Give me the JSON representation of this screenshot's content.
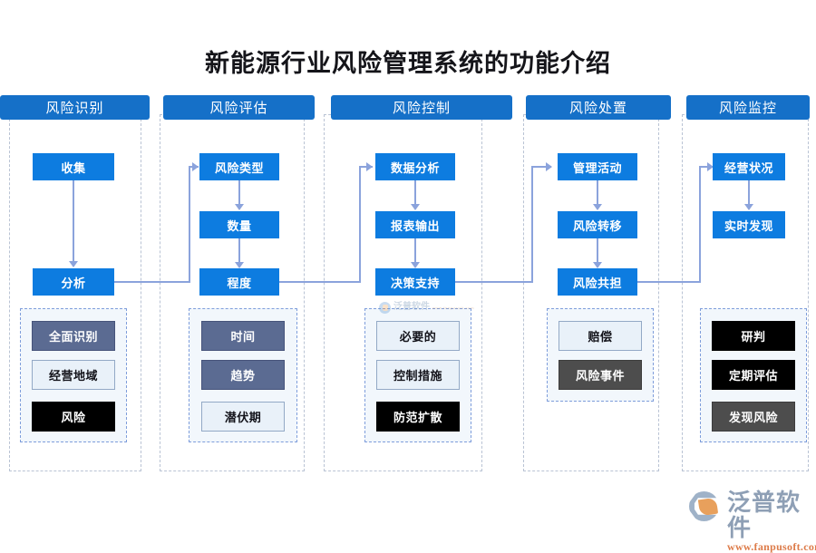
{
  "title": "新能源行业风险管理系统的功能介绍",
  "colors": {
    "header_blue": "#1570c8",
    "box_blue": "#0d7ce0",
    "connector": "#8ba3dc",
    "panel_dash": "#7e9ddb",
    "panel_fill": "#f2f7fc",
    "slate": "#5b6b92",
    "light": "#e9f1f9",
    "black": "#000000",
    "gray": "#4d4d4d",
    "logo_text": "#8e9fb5",
    "logo_url": "#dd7b49"
  },
  "columns": [
    {
      "header": "风险识别",
      "flow": [
        "收集",
        "分析"
      ],
      "items": [
        {
          "label": "全面识别",
          "style": "slate"
        },
        {
          "label": "经营地域",
          "style": "light"
        },
        {
          "label": "风险",
          "style": "black"
        }
      ]
    },
    {
      "header": "风险评估",
      "flow": [
        "风险类型",
        "数量",
        "程度"
      ],
      "items": [
        {
          "label": "时间",
          "style": "slate"
        },
        {
          "label": "趋势",
          "style": "slate"
        },
        {
          "label": "潜伏期",
          "style": "light"
        }
      ]
    },
    {
      "header": "风险控制",
      "flow": [
        "数据分析",
        "报表输出",
        "决策支持"
      ],
      "items": [
        {
          "label": "必要的",
          "style": "light"
        },
        {
          "label": "控制措施",
          "style": "light"
        },
        {
          "label": "防范扩散",
          "style": "black"
        }
      ]
    },
    {
      "header": "风险处置",
      "flow": [
        "管理活动",
        "风险转移",
        "风险共担"
      ],
      "items": [
        {
          "label": "赔偿",
          "style": "light"
        },
        {
          "label": "风险事件",
          "style": "gray"
        }
      ]
    },
    {
      "header": "风险监控",
      "flow": [
        "经营状况",
        "实时发现"
      ],
      "items": [
        {
          "label": "研判",
          "style": "black"
        },
        {
          "label": "定期评估",
          "style": "black"
        },
        {
          "label": "发现风险",
          "style": "gray"
        }
      ]
    }
  ],
  "watermark": {
    "brand": "泛普软件",
    "url": "www.fanpusoft.com"
  }
}
